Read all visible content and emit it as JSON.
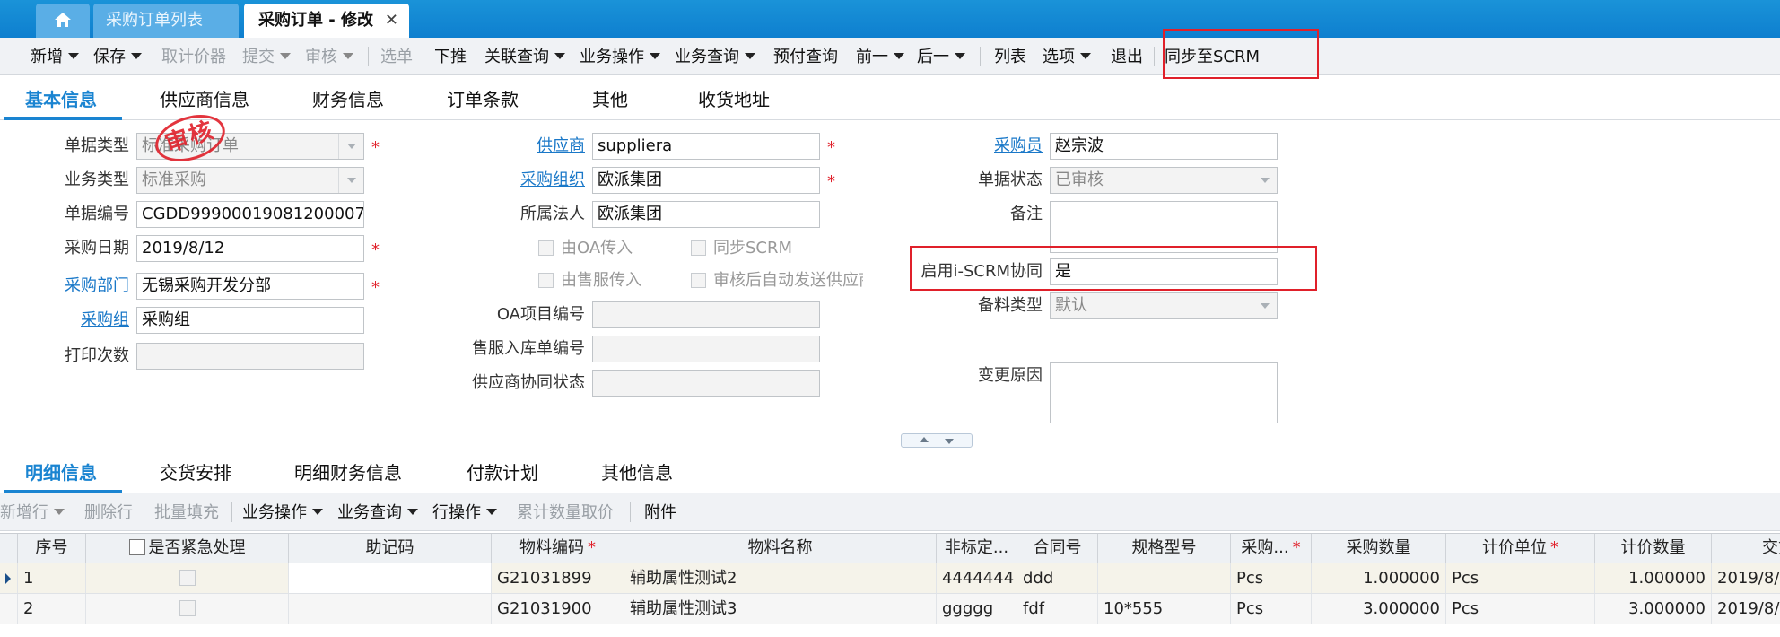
{
  "tabs": {
    "home_icon": "home-icon",
    "list_tab": "采购订单列表",
    "active_tab": "采购订单 - 修改",
    "close": "✕"
  },
  "toolbar": {
    "new": "新增",
    "save": "保存",
    "fetch_price": "取计价器",
    "submit": "提交",
    "audit": "审核",
    "select_order": "选单",
    "push_down": "下推",
    "related_query": "关联查询",
    "business_ops": "业务操作",
    "business_query": "业务查询",
    "prepay_query": "预付查询",
    "prev": "前一",
    "next": "后一",
    "list": "列表",
    "options": "选项",
    "exit": "退出",
    "sync_scrm": "同步至SCRM"
  },
  "header_tabs": [
    "基本信息",
    "供应商信息",
    "财务信息",
    "订单条款",
    "其他",
    "收货地址"
  ],
  "stamp": "审核",
  "form": {
    "doc_type_label": "单据类型",
    "doc_type_value": "标准采购订单",
    "biz_type_label": "业务类型",
    "biz_type_value": "标准采购",
    "doc_no_label": "单据编号",
    "doc_no_value": "CGDD99900019081200007",
    "purchase_date_label": "采购日期",
    "purchase_date_value": "2019/8/12",
    "purchase_dept_label": "采购部门",
    "purchase_dept_value": "无锡采购开发分部",
    "purchase_group_label": "采购组",
    "purchase_group_value": "采购组",
    "print_count_label": "打印次数",
    "print_count_value": "",
    "supplier_label": "供应商",
    "supplier_value": "suppliera",
    "purchase_org_label": "采购组织",
    "purchase_org_value": "欧派集团",
    "legal_entity_label": "所属法人",
    "legal_entity_value": "欧派集团",
    "from_oa_label": "由OA传入",
    "sync_scrm_label": "同步SCRM",
    "from_aftersale_label": "由售服传入",
    "auto_send_label": "审核后自动发送供应商",
    "oa_project_label": "OA项目编号",
    "oa_project_value": "",
    "aftersale_no_label": "售服入库单编号",
    "aftersale_no_value": "",
    "supplier_collab_label": "供应商协同状态",
    "supplier_collab_value": "",
    "buyer_label": "采购员",
    "buyer_value": "赵宗波",
    "doc_status_label": "单据状态",
    "doc_status_value": "已审核",
    "remark_label": "备注",
    "remark_value": "",
    "iscrm_label": "启用i-SCRM协同",
    "iscrm_value": "是",
    "prep_type_label": "备料类型",
    "prep_type_value": "默认",
    "change_reason_label": "变更原因",
    "change_reason_value": ""
  },
  "detail_tabs": [
    "明细信息",
    "交货安排",
    "明细财务信息",
    "付款计划",
    "其他信息"
  ],
  "detail_toolbar": {
    "add_row": "新增行",
    "delete_row": "删除行",
    "batch_fill": "批量填充",
    "business_ops": "业务操作",
    "business_query": "业务查询",
    "row_ops": "行操作",
    "cum_qty_price": "累计数量取价",
    "attachment": "附件"
  },
  "grid": {
    "columns": [
      "序号",
      "是否紧急处理",
      "助记码",
      "物料编码",
      "物料名称",
      "非标定...",
      "合同号",
      "规格型号",
      "采购...",
      "采购数量",
      "计价单位",
      "计价数量",
      "交货"
    ],
    "rows": [
      {
        "seq": "1",
        "mnemonic": "",
        "material_code": "G21031899",
        "material_name": "辅助属性测试2",
        "nonstd": "4444444",
        "contract": "ddd",
        "spec": "",
        "unit": "Pcs",
        "qty": "1.000000",
        "price_unit": "Pcs",
        "price_qty": "1.000000",
        "delivery": "2019/8/"
      },
      {
        "seq": "2",
        "mnemonic": "",
        "material_code": "G21031900",
        "material_name": "辅助属性测试3",
        "nonstd": "ggggg",
        "contract": "fdf",
        "spec": "10*555",
        "unit": "Pcs",
        "qty": "3.000000",
        "price_unit": "Pcs",
        "price_qty": "3.000000",
        "delivery": "2019/8/"
      }
    ]
  },
  "colors": {
    "accent": "#1a84d1",
    "topbar": "#0e7fcf",
    "highlight": "#e0202a"
  }
}
